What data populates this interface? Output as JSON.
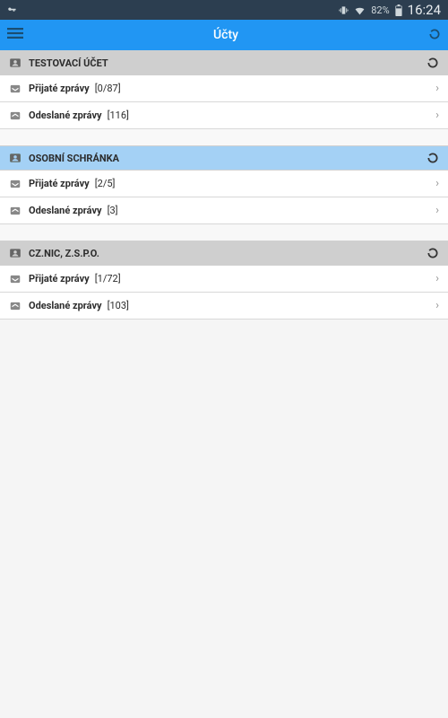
{
  "status_bar": {
    "battery_text": "82%",
    "time": "16:24"
  },
  "header": {
    "title": "Účty"
  },
  "accounts": [
    {
      "name": "TESTOVACÍ  ÚČET",
      "style": "gray",
      "received": {
        "label": "Přijaté zprávy",
        "counter": "[0/87]"
      },
      "sent": {
        "label": "Odeslané zprávy",
        "counter": "[116]"
      }
    },
    {
      "name": "OSOBNÍ  SCHRÁNKA",
      "style": "blue",
      "received": {
        "label": "Přijaté zprávy",
        "counter": "[2/5]"
      },
      "sent": {
        "label": "Odeslané zprávy",
        "counter": "[3]"
      }
    },
    {
      "name": "CZ.NIC, Z.S.P.O.",
      "style": "gray",
      "received": {
        "label": "Přijaté zprávy",
        "counter": "[1/72]"
      },
      "sent": {
        "label": "Odeslané zprávy",
        "counter": "[103]"
      }
    }
  ]
}
